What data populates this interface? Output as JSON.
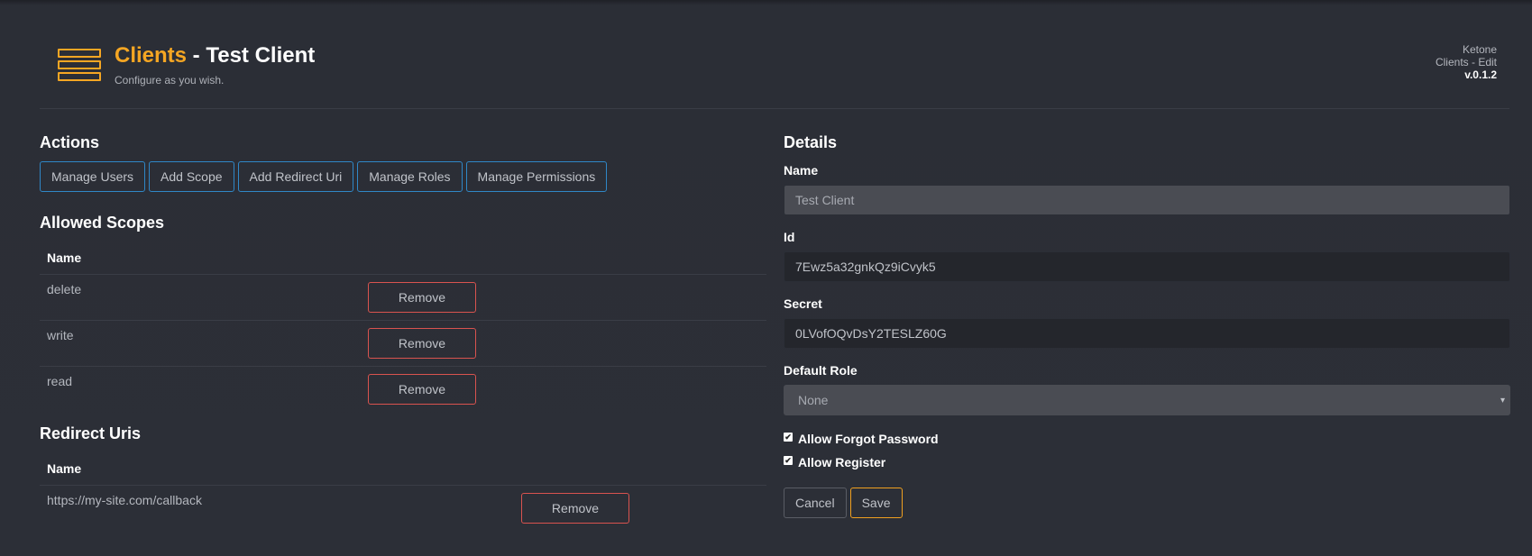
{
  "header": {
    "title_accent": "Clients",
    "title_rest": " - Test Client",
    "subtitle": "Configure as you wish.",
    "meta_app": "Ketone",
    "meta_page": "Clients - Edit",
    "meta_version": "v.0.1.2",
    "icon": "list-icon",
    "accent_color": "#f5a623"
  },
  "actions": {
    "heading": "Actions",
    "buttons": [
      "Manage Users",
      "Add Scope",
      "Add Redirect Uri",
      "Manage Roles",
      "Manage Permissions"
    ]
  },
  "allowed_scopes": {
    "heading": "Allowed Scopes",
    "column_name": "Name",
    "rows": [
      {
        "name": "delete",
        "action": "Remove"
      },
      {
        "name": "write",
        "action": "Remove"
      },
      {
        "name": "read",
        "action": "Remove"
      }
    ]
  },
  "redirect_uris": {
    "heading": "Redirect Uris",
    "column_name": "Name",
    "rows": [
      {
        "name": "https://my-site.com/callback",
        "action": "Remove"
      }
    ]
  },
  "details": {
    "heading": "Details",
    "name_label": "Name",
    "name_value": "Test Client",
    "id_label": "Id",
    "id_value": "7Ewz5a32gnkQz9iCvyk5",
    "secret_label": "Secret",
    "secret_value": "0LVofOQvDsY2TESLZ60G",
    "role_label": "Default Role",
    "role_value": "None",
    "forgot_password_label": "Allow Forgot Password",
    "forgot_password_checked": true,
    "register_label": "Allow Register",
    "register_checked": true,
    "cancel_label": "Cancel",
    "save_label": "Save"
  }
}
